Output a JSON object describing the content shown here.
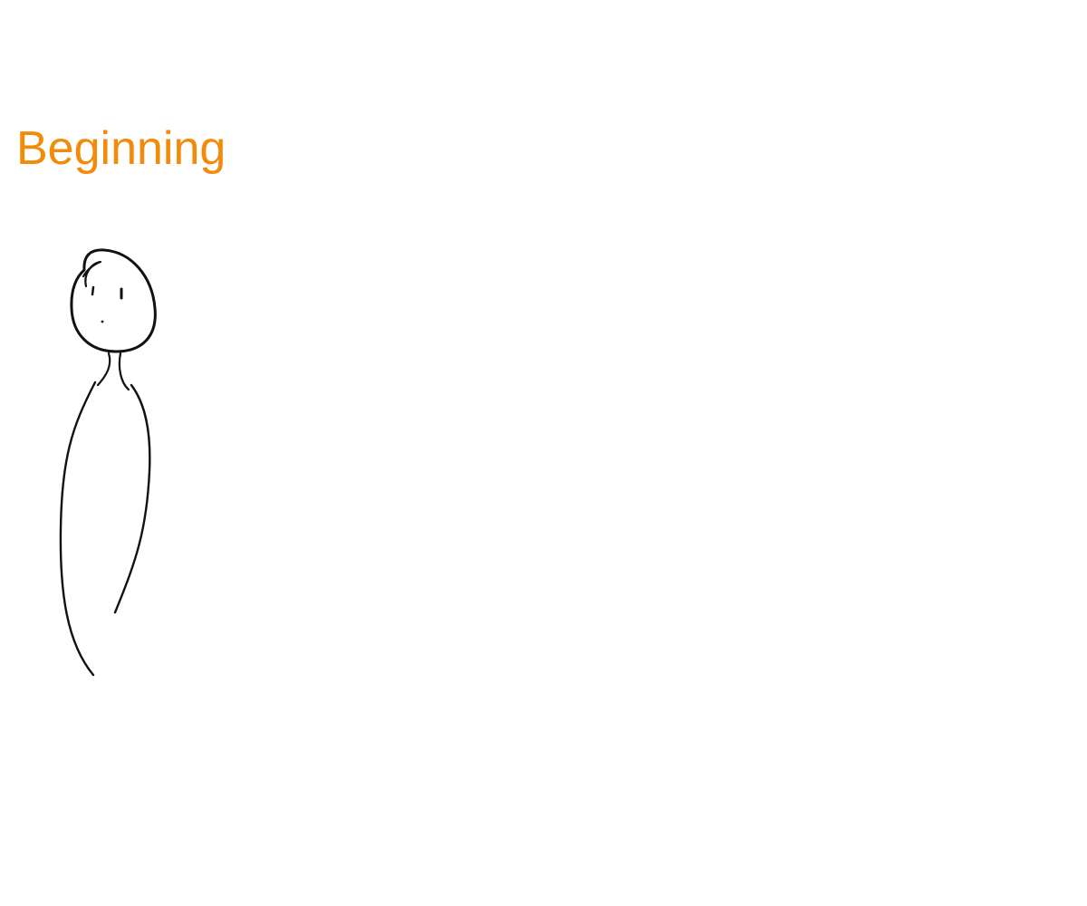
{
  "heading": {
    "text": "Beginning",
    "color": "#f28a0a"
  },
  "illustration": {
    "subject": "stick-figure-person",
    "stroke_color": "#111111"
  }
}
